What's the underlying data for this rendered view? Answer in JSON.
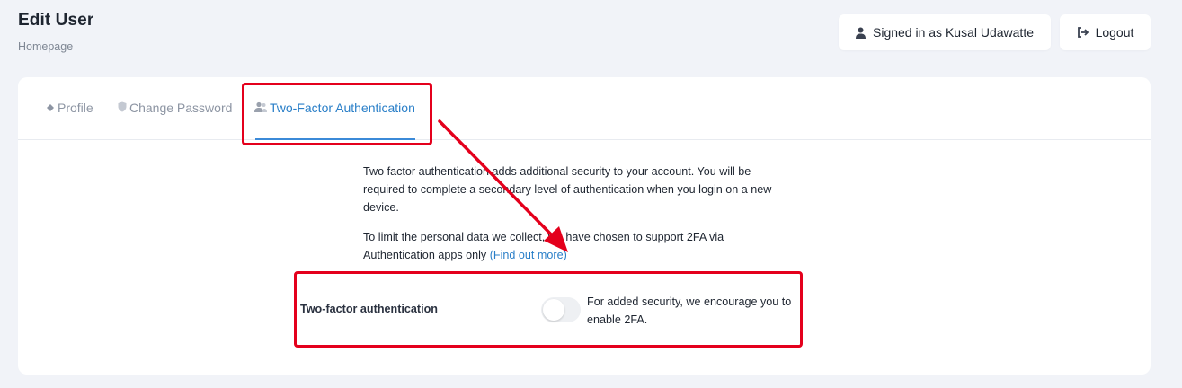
{
  "header": {
    "title": "Edit User",
    "subtitle": "Homepage",
    "signed_in_label": "Signed in as Kusal Udawatte",
    "logout_label": "Logout"
  },
  "tabs": [
    {
      "label": "Profile",
      "icon": "diamond-icon",
      "active": false
    },
    {
      "label": "Change Password",
      "icon": "shield-icon",
      "active": false
    },
    {
      "label": "Two-Factor Authentication",
      "icon": "users-icon",
      "active": true
    }
  ],
  "content": {
    "paragraph1": "Two factor authentication adds additional security to your account. You will be required to complete a secondary level of authentication when you login on a new device.",
    "paragraph2_text": "To limit the personal data we collect, we have chosen to support 2FA via Authentication apps only ",
    "paragraph2_link": "(Find out more)"
  },
  "two_factor": {
    "label": "Two-factor authentication",
    "enabled": false,
    "description": "For added security, we encourage you to enable 2FA."
  },
  "colors": {
    "accent": "#2a7fc8",
    "annotation": "#e4001c",
    "background": "#f1f3f8"
  }
}
